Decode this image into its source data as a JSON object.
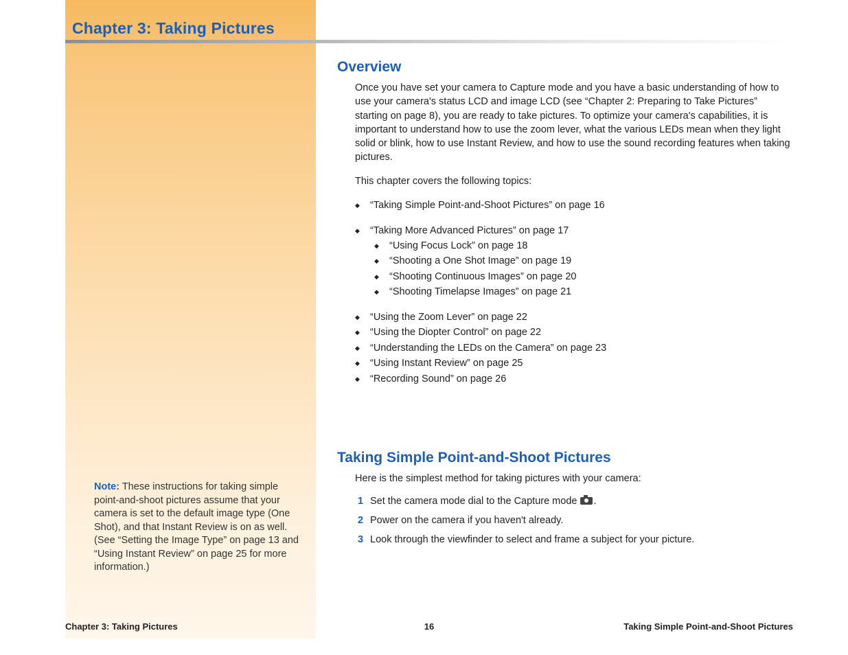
{
  "chapter_title": "Chapter 3: Taking Pictures",
  "sidebar_note": {
    "label": "Note:",
    "text": " These instructions for taking simple point-and-shoot pictures assume that your camera is set to the default image type (One Shot), and that Instant Review is on as well. (See “Setting the Image Type” on page 13 and “Using Instant Review” on page 25 for more information.)"
  },
  "overview": {
    "heading": "Overview",
    "para1": "Once you have set your camera to Capture mode and you have a basic understanding of how to use your camera's status LCD and image LCD (see “Chapter 2: Preparing to Take Pictures” starting on page 8), you are ready to take pictures. To optimize your camera's capabilities, it is important to understand how to use the zoom lever, what the various LEDs mean when they light solid or blink, how to use Instant Review, and how to use the sound recording features when taking pictures.",
    "para2": "This chapter covers the following topics:",
    "topics": {
      "t1": "“Taking Simple Point-and-Shoot Pictures” on page 16",
      "t2": "“Taking More Advanced Pictures” on page 17",
      "t2a": "“Using Focus Lock” on page 18",
      "t2b": "“Shooting a One Shot Image” on page 19",
      "t2c": "“Shooting Continuous Images” on page 20",
      "t2d": "“Shooting Timelapse Images” on page 21",
      "t3": "“Using the Zoom Lever” on page 22",
      "t4": "“Using the Diopter Control” on page 22",
      "t5": "“Understanding the LEDs on the Camera” on page 23",
      "t6": "“Using Instant Review” on page 25",
      "t7": "“Recording Sound” on page 26"
    }
  },
  "section2": {
    "heading": "Taking Simple Point-and-Shoot Pictures",
    "intro": "Here is the simplest method for taking pictures with your camera:",
    "steps": {
      "n1": "1",
      "s1a": "Set the camera mode dial to the Capture mode ",
      "s1b": ".",
      "n2": "2",
      "s2": "Power on the camera if you haven't already.",
      "n3": "3",
      "s3": "Look through the viewfinder to select and frame a subject for your picture."
    }
  },
  "footer": {
    "left": "Chapter 3: Taking Pictures",
    "center": "16",
    "right": "Taking Simple Point-and-Shoot Pictures"
  }
}
